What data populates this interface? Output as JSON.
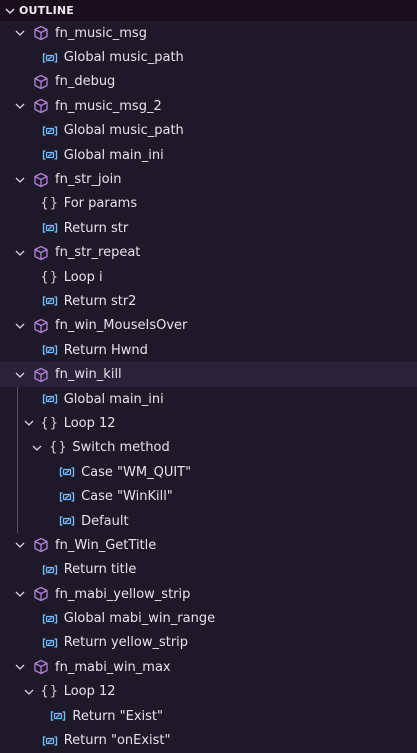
{
  "header": {
    "title": "OUTLINE"
  },
  "colors": {
    "method": "#b180d7",
    "variable": "#75beff",
    "scope": "#d4d0dc",
    "selected_row": "#2a2238"
  },
  "selected_index": 15,
  "items": [
    {
      "label": "fn_music_msg",
      "icon": "method",
      "level": 0,
      "expanded": true
    },
    {
      "label": "Global music_path",
      "icon": "variable",
      "level": 1
    },
    {
      "label": "fn_debug",
      "icon": "method",
      "level": 0
    },
    {
      "label": "fn_music_msg_2",
      "icon": "method",
      "level": 0,
      "expanded": true
    },
    {
      "label": "Global music_path",
      "icon": "variable",
      "level": 1
    },
    {
      "label": "Global main_ini",
      "icon": "variable",
      "level": 1
    },
    {
      "label": "fn_str_join",
      "icon": "method",
      "level": 0,
      "expanded": true
    },
    {
      "label": "For params",
      "icon": "scope",
      "level": 1
    },
    {
      "label": "Return str",
      "icon": "variable",
      "level": 1
    },
    {
      "label": "fn_str_repeat",
      "icon": "method",
      "level": 0,
      "expanded": true
    },
    {
      "label": "Loop i",
      "icon": "scope",
      "level": 1
    },
    {
      "label": "Return str2",
      "icon": "variable",
      "level": 1
    },
    {
      "label": "fn_win_MouseIsOver",
      "icon": "method",
      "level": 0,
      "expanded": true
    },
    {
      "label": "Return Hwnd",
      "icon": "variable",
      "level": 1
    },
    {
      "label": "fn_win_kill",
      "icon": "method",
      "level": 0,
      "expanded": true
    },
    {
      "label": "Global main_ini",
      "icon": "variable",
      "level": 1
    },
    {
      "label": "Loop 12",
      "icon": "scope",
      "level": 1,
      "expanded": true
    },
    {
      "label": "Switch method",
      "icon": "scope",
      "level": 2,
      "expanded": true
    },
    {
      "label": "Case \"WM_QUIT\"",
      "icon": "variable",
      "level": 3
    },
    {
      "label": "Case \"WinKill\"",
      "icon": "variable",
      "level": 3
    },
    {
      "label": "Default",
      "icon": "variable",
      "level": 3
    },
    {
      "label": "fn_Win_GetTitle",
      "icon": "method",
      "level": 0,
      "expanded": true
    },
    {
      "label": "Return title",
      "icon": "variable",
      "level": 1
    },
    {
      "label": "fn_mabi_yellow_strip",
      "icon": "method",
      "level": 0,
      "expanded": true
    },
    {
      "label": "Global mabi_win_range",
      "icon": "variable",
      "level": 1
    },
    {
      "label": "Return yellow_strip",
      "icon": "variable",
      "level": 1
    },
    {
      "label": "fn_mabi_win_max",
      "icon": "method",
      "level": 0,
      "expanded": true
    },
    {
      "label": "Loop 12",
      "icon": "scope",
      "level": 1,
      "expanded": true
    },
    {
      "label": "Return \"Exist\"",
      "icon": "variable",
      "level": 2
    },
    {
      "label": "Return \"onExist\"",
      "icon": "variable",
      "level": 1
    }
  ]
}
